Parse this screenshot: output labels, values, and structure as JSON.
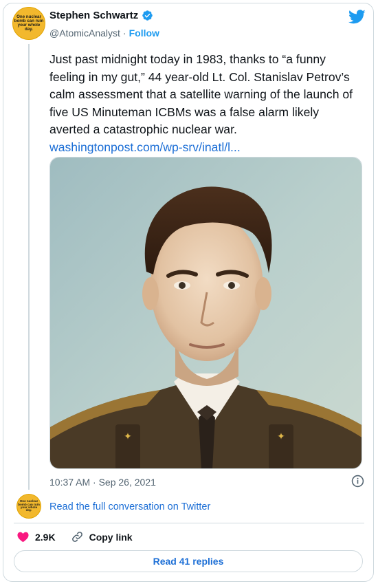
{
  "author": {
    "name": "Stephen Schwartz",
    "handle": "@AtomicAnalyst",
    "separator": "·",
    "follow_label": "Follow",
    "avatar_text": "One nuclear bomb can ruin your whole day."
  },
  "tweet": {
    "text": "Just past midnight today in 1983, thanks to “a funny feeling in my gut,” 44 year-old Lt. Col. Stanislav Petrov’s calm assessment that a satellite warning of the launch of five US Minuteman ICBMs was a false alarm likely averted a catastrophic nuclear war.",
    "link_text": "washingtonpost.com/wp-srv/inatl/l...",
    "timestamp": "10:37 AM · Sep 26, 2021"
  },
  "footer": {
    "read_conversation": "Read the full conversation on Twitter",
    "like_count": "2.9K",
    "copy_link": "Copy link",
    "read_replies": "Read 41 replies"
  },
  "colors": {
    "accent": "#1d9bf0",
    "link": "#1d6fd6",
    "like": "#f91880",
    "avatar": "#f2b82d"
  },
  "icons": [
    "verified-badge-icon",
    "twitter-bird-icon",
    "info-icon",
    "heart-icon",
    "link-icon"
  ]
}
